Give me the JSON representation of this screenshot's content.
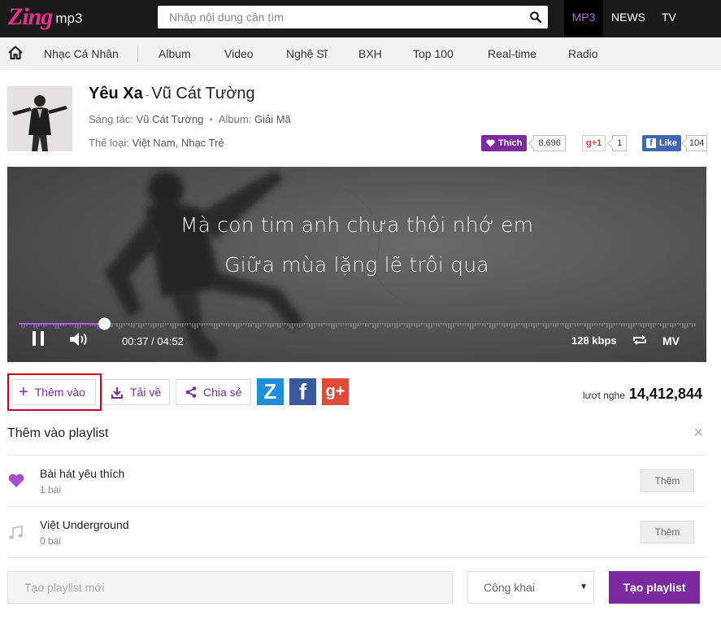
{
  "header": {
    "logo_main": "Zing",
    "logo_sub": "mp3",
    "search_placeholder": "Nhập nội dung cần tìm",
    "nav": [
      "MP3",
      "NEWS",
      "TV"
    ]
  },
  "subnav": {
    "items": [
      "Nhạc Cá Nhân",
      "Album",
      "Video",
      "Nghệ Sĩ",
      "BXH",
      "Top 100",
      "Real-time",
      "Radio"
    ]
  },
  "song": {
    "title": "Yêu Xa",
    "separator": "-",
    "artist": "Vũ Cát Tường",
    "composer_label": "Sáng tác:",
    "composer": "Vũ Cát Tường",
    "album_label": "Album:",
    "album": "Giải Mã",
    "genre_label": "Thể loại:",
    "genre": "Việt Nam, Nhạc Trẻ"
  },
  "social": {
    "like_label": "Thích",
    "like_count": "8,696",
    "gplus_label": "+1",
    "gplus_count": "1",
    "fb_label": "Like",
    "fb_count": "104"
  },
  "player": {
    "lyric_line1": "Mà con tim anh chưa thôi nhớ em",
    "lyric_line2": "Giữa mùa lặng lẽ trôi qua",
    "time": "00:37 / 04:52",
    "progress": 0.127,
    "bitrate": "128 kbps",
    "mv_label": "MV"
  },
  "actions": {
    "add_label": "Thêm vào",
    "download_label": "Tải về",
    "share_label": "Chia sẻ",
    "plays_label": "lượt nghe",
    "plays_count": "14,412,844"
  },
  "playlist_panel": {
    "title": "Thêm vào playlist",
    "items": [
      {
        "name": "Bài hát yêu thích",
        "count": "1 bài",
        "icon": "heart-icon",
        "add_label": "Thêm"
      },
      {
        "name": "Việt Underground",
        "count": "0 bài",
        "icon": "music-note-icon",
        "add_label": "Thêm"
      }
    ],
    "new_placeholder": "Tạo playlist mới",
    "privacy_value": "Công khai",
    "create_label": "Tạo playlist"
  },
  "colors": {
    "accent": "#7b2aa0",
    "header_bg": "#1a1a1a",
    "highlight_border": "#d0021b"
  }
}
